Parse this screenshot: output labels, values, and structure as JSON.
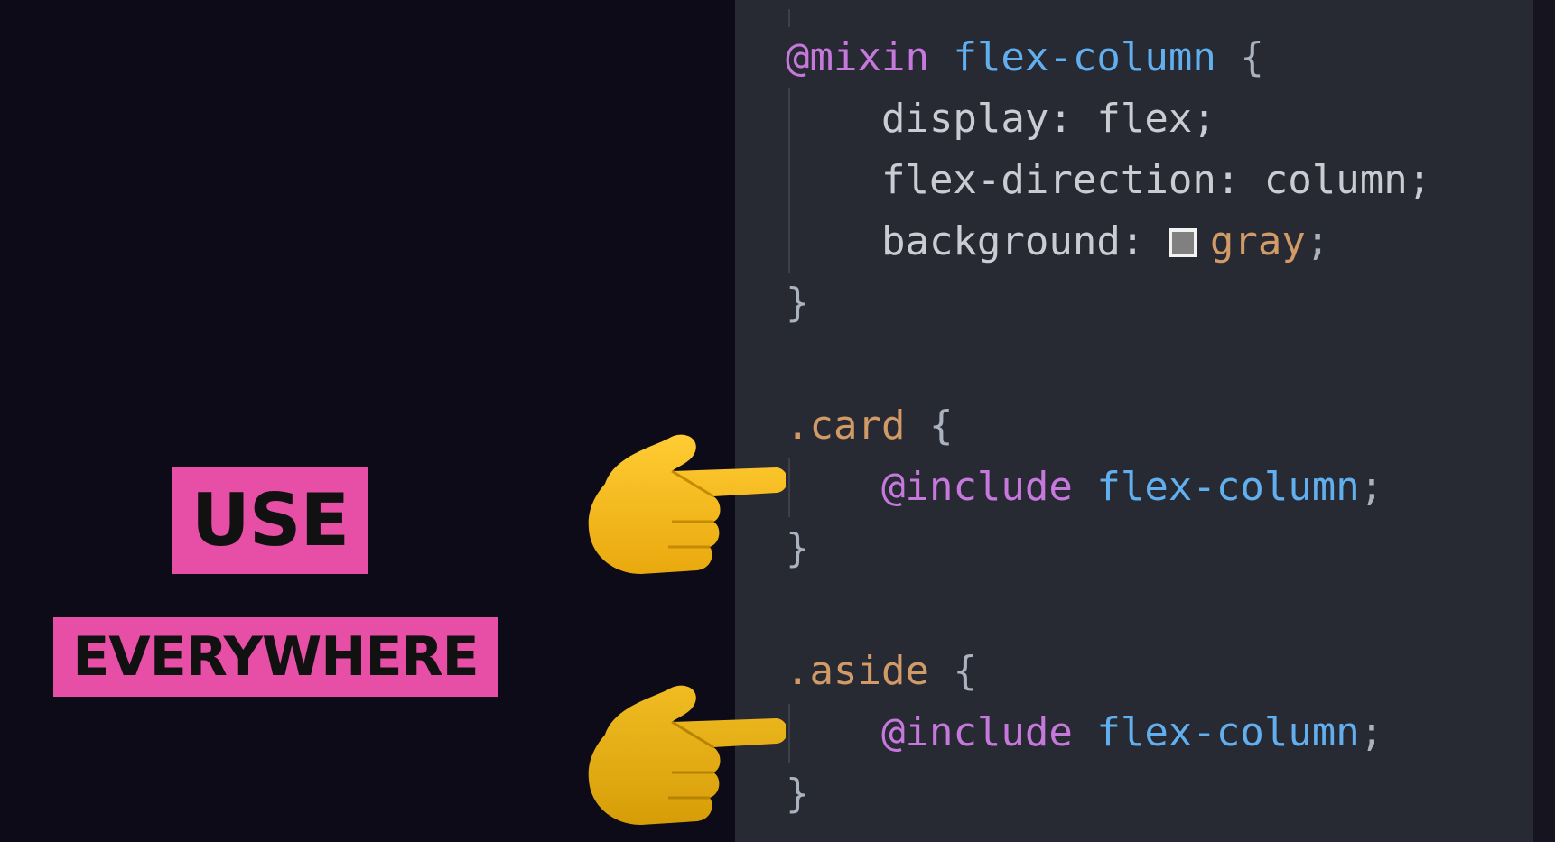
{
  "overlay": {
    "use_label": "USE",
    "everywhere_label": "EVERYWHERE"
  },
  "code": {
    "mixin_kw": "@mixin",
    "mixin_name": "flex-column",
    "open_brace": " {",
    "line_display": "    display: flex;",
    "line_flex_direction": "    flex-direction: column;",
    "line_background_prop": "    background: ",
    "background_value": "gray",
    "semicolon": ";",
    "close_brace": "}",
    "card_selector": ".card",
    "aside_selector": ".aside",
    "include_kw": "@include",
    "include_name": "flex-column",
    "indent": "    "
  },
  "colors": {
    "banner": "#e74fa6",
    "editor_bg": "#272a33",
    "background_swatch": "#808080"
  },
  "icons": {
    "pointer": "backhand-index-pointing-right-icon"
  }
}
